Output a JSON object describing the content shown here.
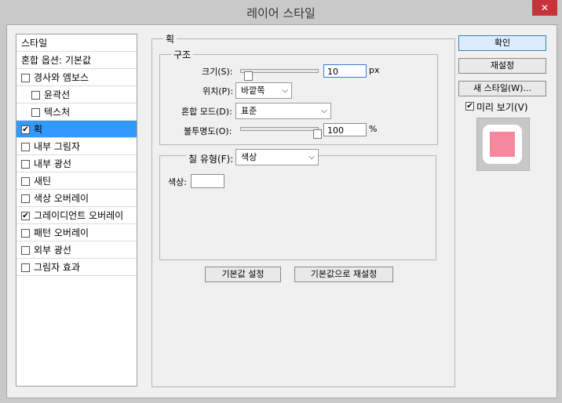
{
  "window": {
    "title": "레이어 스타일",
    "close_glyph": "✕"
  },
  "styles_list": {
    "items": [
      {
        "label": "스타일",
        "has_checkbox": false,
        "checked": false,
        "indent": 0
      },
      {
        "label": "혼합 옵션: 기본값",
        "has_checkbox": false,
        "checked": false,
        "indent": 0
      },
      {
        "label": "경사와 엠보스",
        "has_checkbox": true,
        "checked": false,
        "indent": 0
      },
      {
        "label": "윤곽선",
        "has_checkbox": true,
        "checked": false,
        "indent": 1
      },
      {
        "label": "텍스처",
        "has_checkbox": true,
        "checked": false,
        "indent": 1
      },
      {
        "label": "획",
        "has_checkbox": true,
        "checked": true,
        "indent": 0,
        "selected": true
      },
      {
        "label": "내부 그림자",
        "has_checkbox": true,
        "checked": false,
        "indent": 0
      },
      {
        "label": "내부 광선",
        "has_checkbox": true,
        "checked": false,
        "indent": 0
      },
      {
        "label": "새틴",
        "has_checkbox": true,
        "checked": false,
        "indent": 0
      },
      {
        "label": "색상 오버레이",
        "has_checkbox": true,
        "checked": false,
        "indent": 0
      },
      {
        "label": "그레이디언트 오버레이",
        "has_checkbox": true,
        "checked": true,
        "indent": 0
      },
      {
        "label": "패턴 오버레이",
        "has_checkbox": true,
        "checked": false,
        "indent": 0
      },
      {
        "label": "외부 광선",
        "has_checkbox": true,
        "checked": false,
        "indent": 0
      },
      {
        "label": "그림자 효과",
        "has_checkbox": true,
        "checked": false,
        "indent": 0
      }
    ]
  },
  "stroke_panel": {
    "title": "획",
    "structure": {
      "title": "구조",
      "size_label": "크기(S):",
      "size_value": "10",
      "size_unit": "px",
      "size_slider_fraction": 0.1,
      "position_label": "위치(P):",
      "position_value": "바깥쪽",
      "blend_label": "혼합 모드(D):",
      "blend_value": "표준",
      "opacity_label": "불투명도(O):",
      "opacity_value": "100",
      "opacity_unit": "%",
      "opacity_slider_fraction": 1.0
    },
    "fill": {
      "type_label": "칠 유형(F):",
      "type_value": "색상",
      "color_label": "색상:",
      "color_value": "#ffffff"
    },
    "make_default_label": "기본값 설정",
    "reset_default_label": "기본값으로 재설정"
  },
  "actions": {
    "ok_label": "확인",
    "reset_label": "재설정",
    "new_style_label": "새 스타일(W)...",
    "preview_label": "미리 보기(V)",
    "preview_checked": true
  },
  "preview": {
    "fill_color": "#f5889f",
    "frame_color": "#ffffff"
  },
  "glyphs": {
    "checkmark": "✔",
    "chevron": "⌵"
  }
}
